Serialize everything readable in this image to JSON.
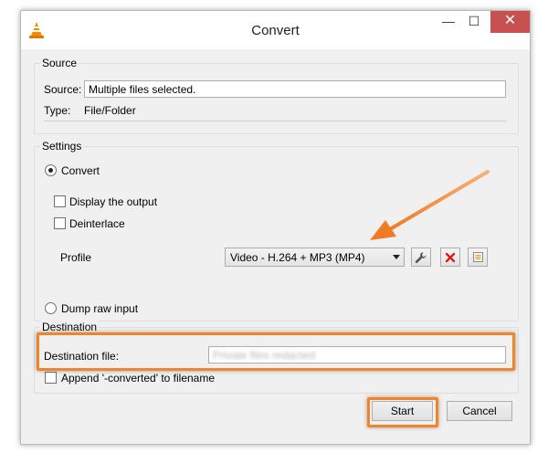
{
  "window": {
    "title": "Convert",
    "minimize_glyph": "—",
    "maximize_glyph": "☐",
    "close_glyph": "✕"
  },
  "source": {
    "group_label": "Source",
    "source_label": "Source:",
    "source_value": "Multiple files selected.",
    "type_label": "Type:",
    "type_value": "File/Folder"
  },
  "settings": {
    "group_label": "Settings",
    "convert_label": "Convert",
    "convert_checked": true,
    "display_output_label": "Display the output",
    "deinterlace_label": "Deinterlace",
    "profile_label": "Profile",
    "profile_value": "Video - H.264 + MP3 (MP4)",
    "dump_raw_label": "Dump raw input",
    "edit_profile_icon": "wrench-icon",
    "delete_profile_icon": "delete-icon",
    "new_profile_icon": "new-profile-icon"
  },
  "destination": {
    "group_label": "Destination",
    "file_label": "Destination file:",
    "file_value": "Private files redacted",
    "append_label": "Append '-converted' to filename"
  },
  "buttons": {
    "start_label": "Start",
    "cancel_label": "Cancel"
  },
  "annotations": {
    "highlight_color": "#f0832f"
  }
}
